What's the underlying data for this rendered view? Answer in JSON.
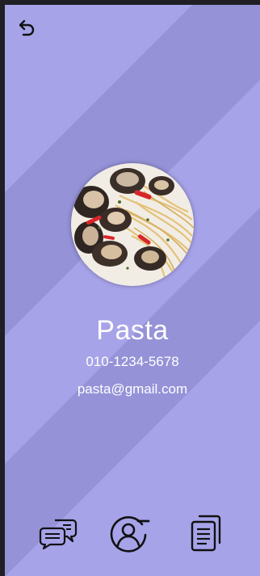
{
  "contact": {
    "name": "Pasta",
    "phone": "010-1234-5678",
    "email": "pasta@gmail.com",
    "photo": "pasta-with-clams"
  },
  "icons": {
    "back": "undo-arrow-icon",
    "nav": [
      "chat-bubbles-icon",
      "user-remove-icon",
      "documents-icon"
    ]
  },
  "colors": {
    "background": "#a7a3e9",
    "stripe": "#918ed0",
    "text": "#ffffff",
    "icon": "#111111"
  }
}
